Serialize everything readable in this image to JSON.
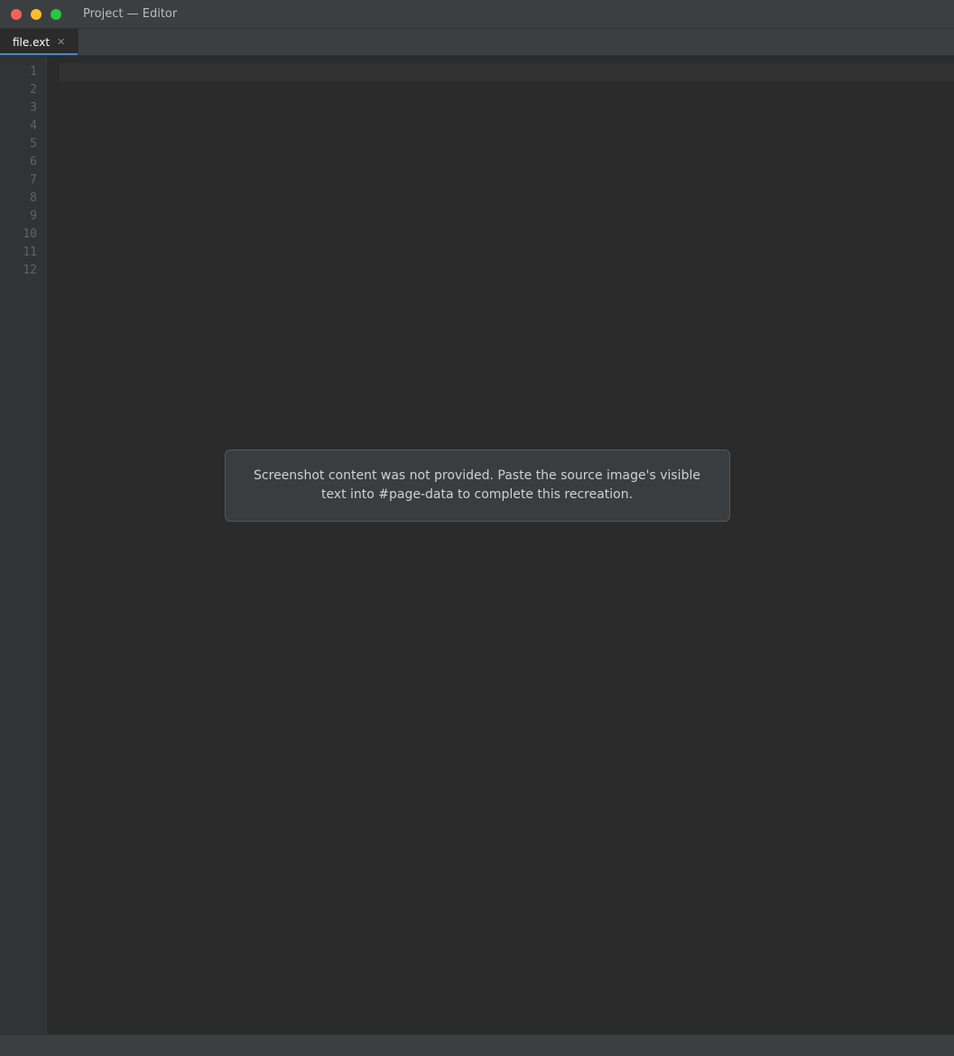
{
  "window": {
    "title": "Project — Editor"
  },
  "tabs": [
    {
      "label": "file.ext"
    }
  ],
  "code": {
    "lines": [
      "",
      "",
      "",
      "",
      "",
      "",
      "",
      "",
      "",
      "",
      "",
      ""
    ]
  },
  "status": {
    "left": "",
    "position": "",
    "encoding": "",
    "line_ending": ""
  },
  "notice": {
    "text": "Screenshot content was not provided. Paste the source image's visible text into #page-data to complete this recreation."
  },
  "colors": {
    "background": "#2b2b2b",
    "accent": "#4a88c7",
    "titlebar": "#3c3f41"
  }
}
